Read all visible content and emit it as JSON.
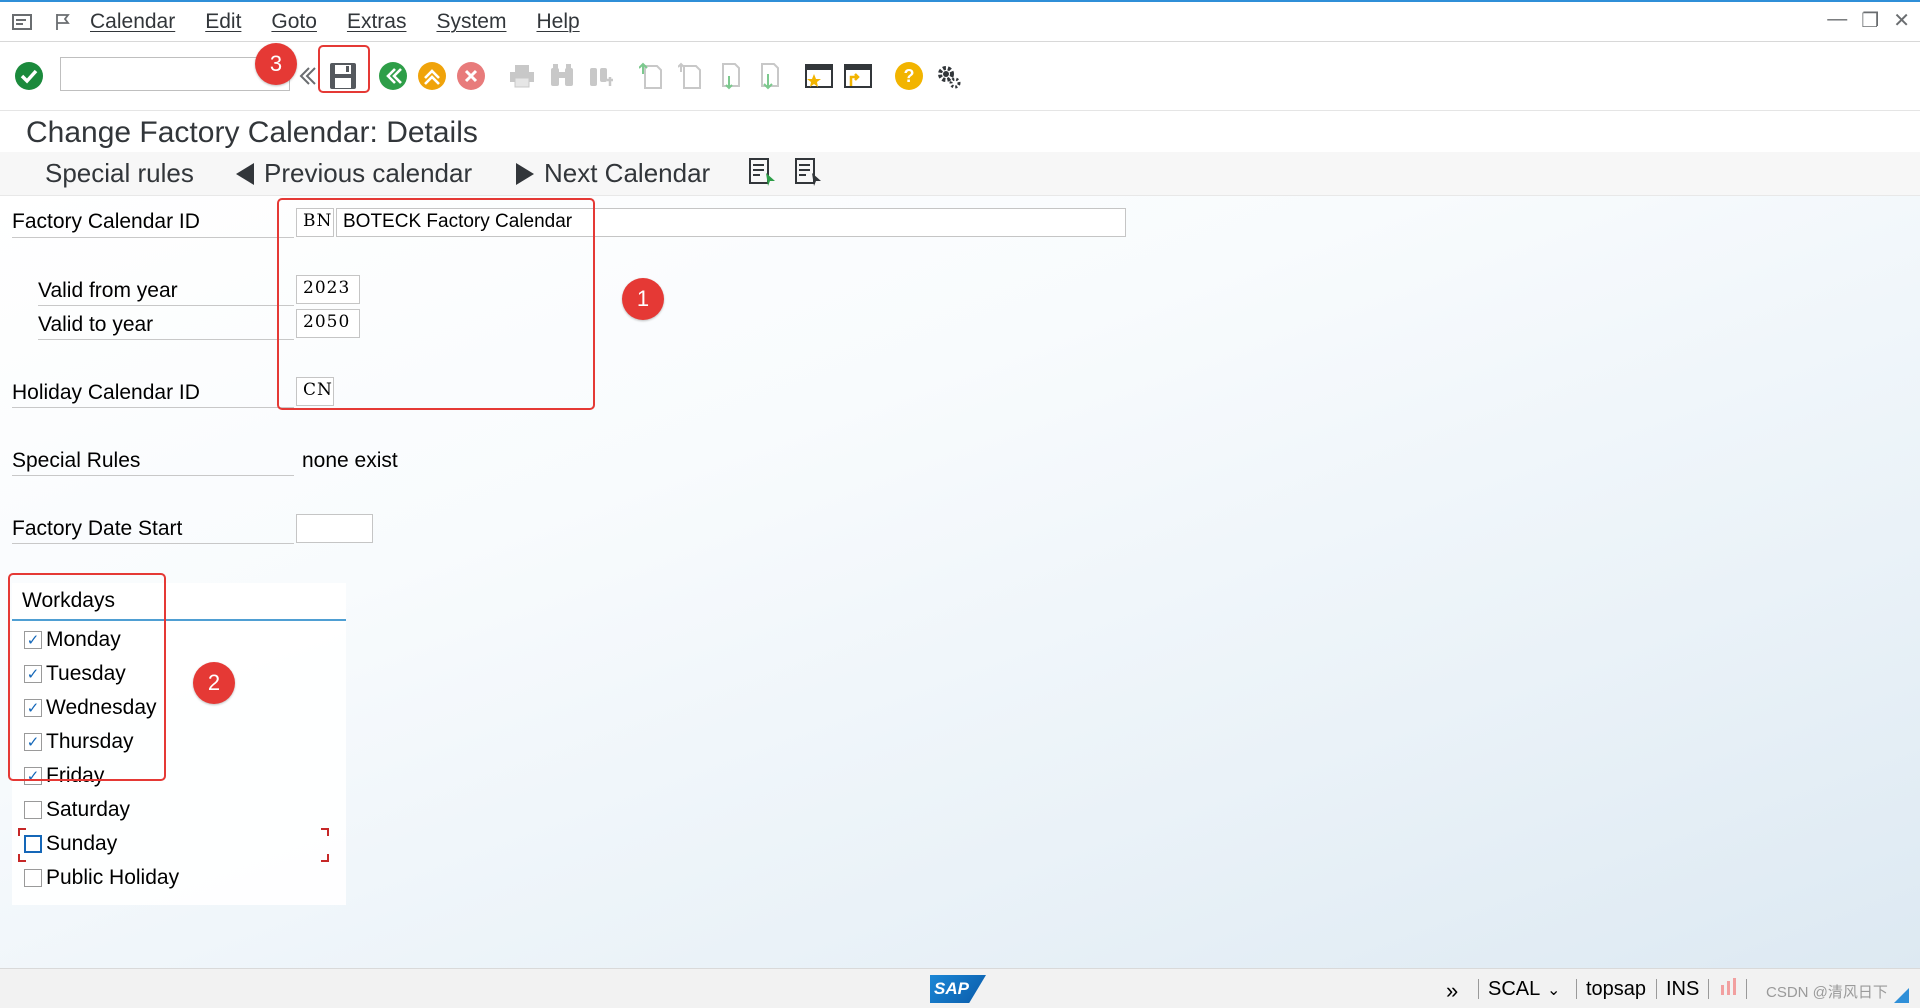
{
  "menu": {
    "items": [
      "Calendar",
      "Edit",
      "Goto",
      "Extras",
      "System",
      "Help"
    ]
  },
  "toolbar": {
    "command_field_value": "",
    "badge_3": "3"
  },
  "title": "Change Factory Calendar: Details",
  "app_toolbar": {
    "special_rules": "Special rules",
    "previous_calendar": "Previous calendar",
    "next_calendar": "Next Calendar"
  },
  "form": {
    "factory_calendar_id_label": "Factory Calendar ID",
    "factory_calendar_id": "BN",
    "factory_calendar_name": "BOTECK Factory Calendar",
    "valid_from_label": "Valid from year",
    "valid_from": "2023",
    "valid_to_label": "Valid to year",
    "valid_to": "2050",
    "holiday_calendar_label": "Holiday Calendar ID",
    "holiday_calendar_id": "CN",
    "special_rules_label": "Special Rules",
    "special_rules_value": "none exist",
    "factory_date_start_label": "Factory Date Start",
    "factory_date_start": ""
  },
  "workdays": {
    "title": "Workdays",
    "days": [
      {
        "label": "Monday",
        "checked": true
      },
      {
        "label": "Tuesday",
        "checked": true
      },
      {
        "label": "Wednesday",
        "checked": true
      },
      {
        "label": "Thursday",
        "checked": true
      },
      {
        "label": "Friday",
        "checked": true
      },
      {
        "label": "Saturday",
        "checked": false
      },
      {
        "label": "Sunday",
        "checked": false
      },
      {
        "label": "Public Holiday",
        "checked": false
      }
    ]
  },
  "annotations": {
    "badge_1": "1",
    "badge_2": "2"
  },
  "statusbar": {
    "sap": "SAP",
    "transaction": "SCAL",
    "server": "topsap",
    "mode": "INS",
    "watermark": "CSDN @清风日下"
  },
  "colors": {
    "accent": "#2f8fd8",
    "annotation_red": "#e53935",
    "check_green": "#1b8a3c",
    "nav_green": "#2e9e48",
    "exit_orange": "#f0a30a",
    "cancel_red": "#e87b7b",
    "help_yellow": "#f2b400"
  }
}
